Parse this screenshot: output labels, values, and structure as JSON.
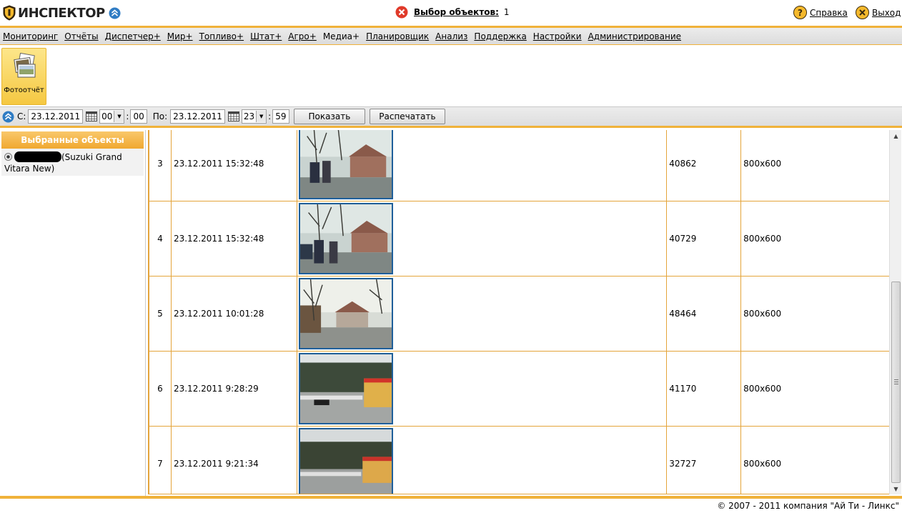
{
  "header": {
    "logo_text": "ИНСПЕКТОР",
    "selection_label": "Выбор объектов:",
    "selection_count": "1",
    "help_label": "Справка",
    "exit_label": "Выход"
  },
  "menu": {
    "items": [
      {
        "label": "Мониторинг"
      },
      {
        "label": "Отчёты"
      },
      {
        "label": "Диспетчер+"
      },
      {
        "label": "Мир+"
      },
      {
        "label": "Топливо+"
      },
      {
        "label": "Штат+"
      },
      {
        "label": "Агро+"
      },
      {
        "label": "Медиа+"
      },
      {
        "label": "Планировщик"
      },
      {
        "label": "Анализ"
      },
      {
        "label": "Поддержка"
      },
      {
        "label": "Настройки"
      },
      {
        "label": "Администрирование"
      }
    ]
  },
  "ribbon": {
    "photo_report_label": "Фотоотчёт"
  },
  "filter": {
    "from_label": "С:",
    "from_date": "23.12.2011",
    "from_hour": "00",
    "from_minute": "00",
    "to_label": "По:",
    "to_date": "23.12.2011",
    "to_hour": "23",
    "to_minute": "59",
    "colon": ":",
    "show_button": "Показать",
    "print_button": "Распечатать"
  },
  "sidebar": {
    "title": "Выбранные объекты",
    "object_name": "(Suzuki Grand Vitara New)"
  },
  "rows": [
    {
      "n": "3",
      "datetime": "23.12.2011 15:32:48",
      "size": "40862",
      "resolution": "800x600"
    },
    {
      "n": "4",
      "datetime": "23.12.2011 15:32:48",
      "size": "40729",
      "resolution": "800x600"
    },
    {
      "n": "5",
      "datetime": "23.12.2011 10:01:28",
      "size": "48464",
      "resolution": "800x600"
    },
    {
      "n": "6",
      "datetime": "23.12.2011 9:28:29",
      "size": "41170",
      "resolution": "800x600"
    },
    {
      "n": "7",
      "datetime": "23.12.2011 9:21:34",
      "size": "32727",
      "resolution": "800x600"
    }
  ],
  "footer": {
    "copyright": "© 2007 - 2011 компания \"Ай Ти - Линкс\""
  },
  "colors": {
    "accent": "#f0b23a",
    "thumb_border": "#1f5f9a"
  }
}
